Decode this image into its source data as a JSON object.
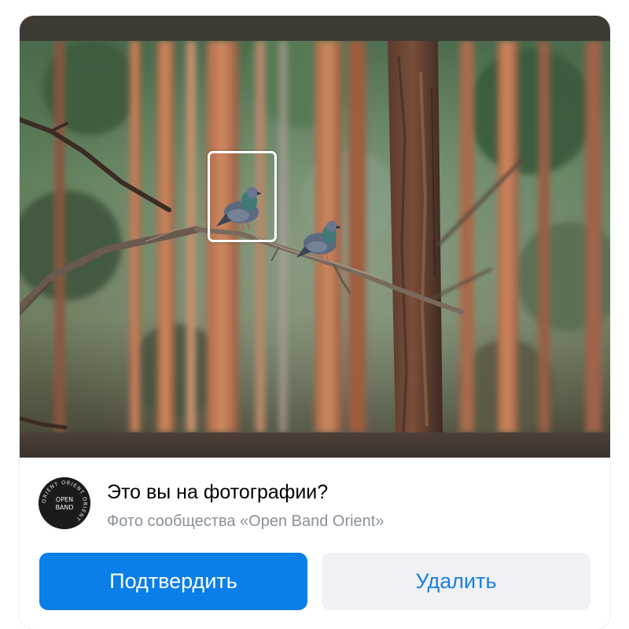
{
  "dialog": {
    "question": "Это вы на фотографии?",
    "subtitle": "Фото сообщества «Open Band Orient»",
    "confirm_label": "Подтвердить",
    "delete_label": "Удалить"
  },
  "avatar": {
    "ring_text": "ORIENT ORIENT ORIENT",
    "logo_line1": "OPEN",
    "logo_line2": "BAND"
  },
  "colors": {
    "confirm_bg": "#0a7ee9",
    "delete_bg": "#eff1f4",
    "delete_text": "#1a7fe0",
    "subtitle": "#8a9099"
  },
  "photo": {
    "subject": "two pigeons on a pine branch in a forest",
    "face_marker": "white rounded rectangle around left pigeon"
  }
}
